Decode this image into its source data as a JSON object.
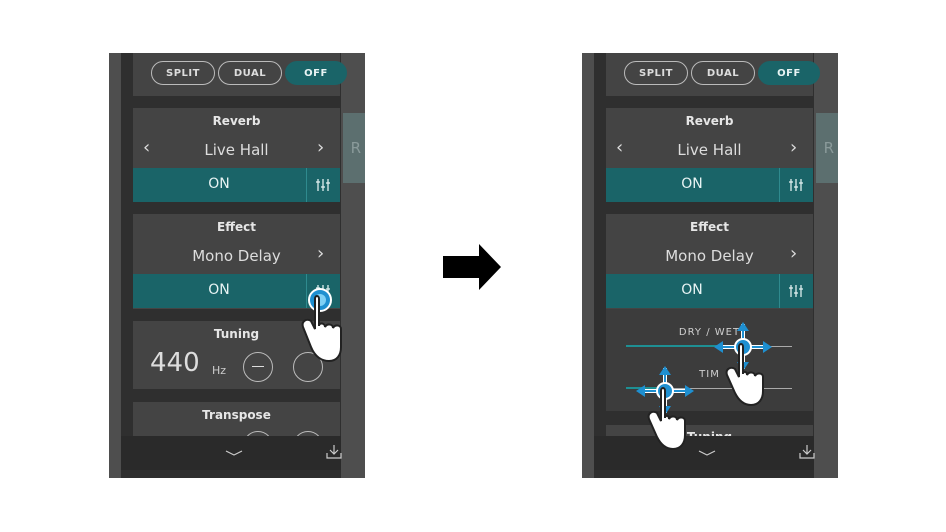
{
  "left": {
    "modes": [
      "SPLIT",
      "DUAL",
      "OFF"
    ],
    "reverb": {
      "title": "Reverb",
      "value": "Live Hall",
      "on": "ON"
    },
    "effect": {
      "title": "Effect",
      "value": "Mono Delay",
      "on": "ON"
    },
    "tuning": {
      "title": "Tuning",
      "value": "440",
      "unit": "Hz"
    },
    "transpose": {
      "title": "Transpose"
    },
    "peek_letter": "R"
  },
  "right": {
    "modes": [
      "SPLIT",
      "DUAL",
      "OFF"
    ],
    "reverb": {
      "title": "Reverb",
      "value": "Live Hall",
      "on": "ON"
    },
    "effect": {
      "title": "Effect",
      "value": "Mono Delay",
      "on": "ON"
    },
    "sliders": {
      "dry_wet": "DRY / WET",
      "time": "TIM"
    },
    "tuning": {
      "title": "Tuning"
    },
    "peek_letter": "R"
  },
  "icons": {
    "prev": "chevron-left-icon",
    "next": "chevron-right-icon",
    "mixer": "mixer-sliders-icon",
    "collapse": "chevron-down-icon",
    "download": "download-icon",
    "hand": "hand-pointer-icon",
    "arrow": "right-arrow-icon"
  },
  "colors": {
    "accent": "#1a6468",
    "panel": "#444444",
    "background": "#2f2f2f",
    "highlight": "#1e8f93"
  }
}
